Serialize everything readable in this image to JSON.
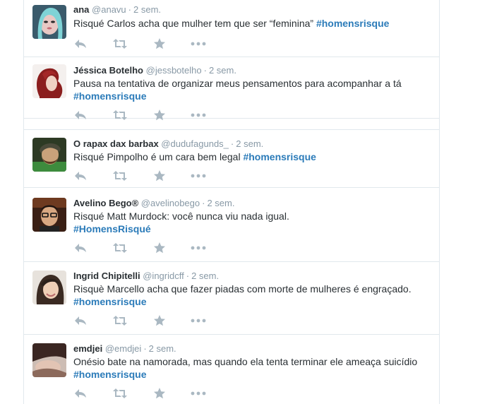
{
  "tweets": [
    {
      "name": "ana",
      "handle": "@anavu",
      "time": "2 sem.",
      "text": "Risqué Carlos acha que mulher tem que ser “feminina” ",
      "hashtag": "#homensrisque",
      "hashtag_newline": false
    },
    {
      "name": "Jéssica Botelho",
      "handle": "@jessbotelho",
      "time": "2 sem.",
      "text": "Pausa na tentativa de organizar meus pensamentos para acompanhar a tá",
      "hashtag": "#homensrisque",
      "hashtag_newline": true
    },
    {
      "name": "O rapax dax barbax",
      "handle": "@dudufagunds_",
      "time": "2 sem.",
      "text": "Risqué Pimpolho é um cara bem legal ",
      "hashtag": "#homensrisque",
      "hashtag_newline": false
    },
    {
      "name": "Avelino Bego®",
      "handle": "@avelinobego",
      "time": "2 sem.",
      "text": "Risqué Matt Murdock: você nunca viu nada igual.",
      "hashtag": "#HomensRisqué",
      "hashtag_newline": true
    },
    {
      "name": "Ingrid Chipitelli",
      "handle": "@ingridcff",
      "time": "2 sem.",
      "text": "Risquè Marcello acha que fazer piadas com morte de mulheres é engraçado.",
      "hashtag": "#homensrisque",
      "hashtag_newline": true
    },
    {
      "name": "emdjei",
      "handle": "@emdjei",
      "time": "2 sem.",
      "text": "Onésio bate na namorada, mas quando ela tenta terminar ele ameaça suicídio",
      "hashtag": "#homensrisque",
      "hashtag_newline": true
    }
  ],
  "separator": "·",
  "icons": [
    "reply-icon",
    "retweet-icon",
    "favorite-icon",
    "more-icon"
  ],
  "colors": {
    "name": "#292f33",
    "meta": "#8899a6",
    "hashtag": "#2b7bb9",
    "action_icon": "#aab8c2",
    "border": "#e1e8ed"
  }
}
